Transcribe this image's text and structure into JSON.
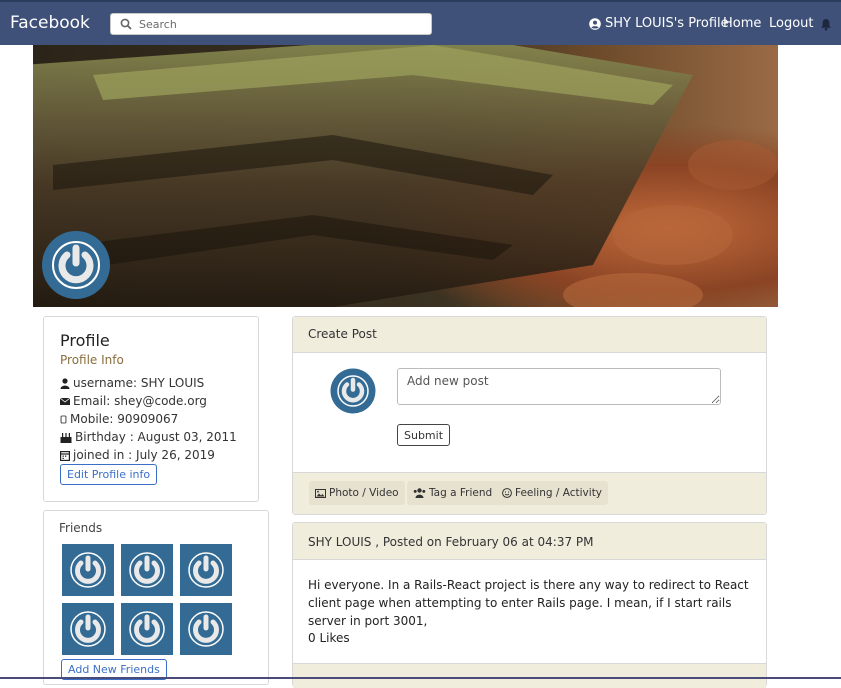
{
  "navbar": {
    "brand": "Facebook",
    "search_placeholder": "Search",
    "profile_link": "SHY LOUIS's Profile",
    "home_link": "Home",
    "logout_link": "Logout"
  },
  "profile": {
    "title": "Profile",
    "subtitle": "Profile Info",
    "username_line": "username: SHY LOUIS",
    "email_line": "Email: shey@code.org",
    "mobile_line": "Mobile: 90909067",
    "birthday_line": "Birthday : August 03, 2011",
    "joined_line": "joined in : July 26, 2019",
    "edit_button": "Edit Profile info"
  },
  "friends": {
    "title": "Friends",
    "add_button": "Add New Friends",
    "count": 6
  },
  "create_post": {
    "header": "Create Post",
    "placeholder": "Add new post",
    "submit": "Submit",
    "photo_video": "Photo / Video",
    "tag_friend": "Tag a Friend",
    "feeling_activity": "Feeling / Activity"
  },
  "post": {
    "header": "SHY LOUIS , Posted on February 06 at 04:37 PM",
    "body": "Hi everyone. In a Rails-React project is there any way to redirect to React client page when attempting to enter Rails page. I mean, if I start rails server in port 3001,",
    "likes": "0 Likes"
  },
  "colors": {
    "navbar": "#3f5179",
    "card_header": "#f1eddd",
    "avatar_blue": "#336b94",
    "link_blue": "#3b6fc7"
  },
  "icons": [
    "search-icon",
    "user-circle-icon",
    "bell-icon",
    "user-icon",
    "envelope-icon",
    "mobile-icon",
    "birthday-cake-icon",
    "calendar-icon",
    "image-icon",
    "users-icon",
    "smile-icon",
    "power-icon"
  ]
}
